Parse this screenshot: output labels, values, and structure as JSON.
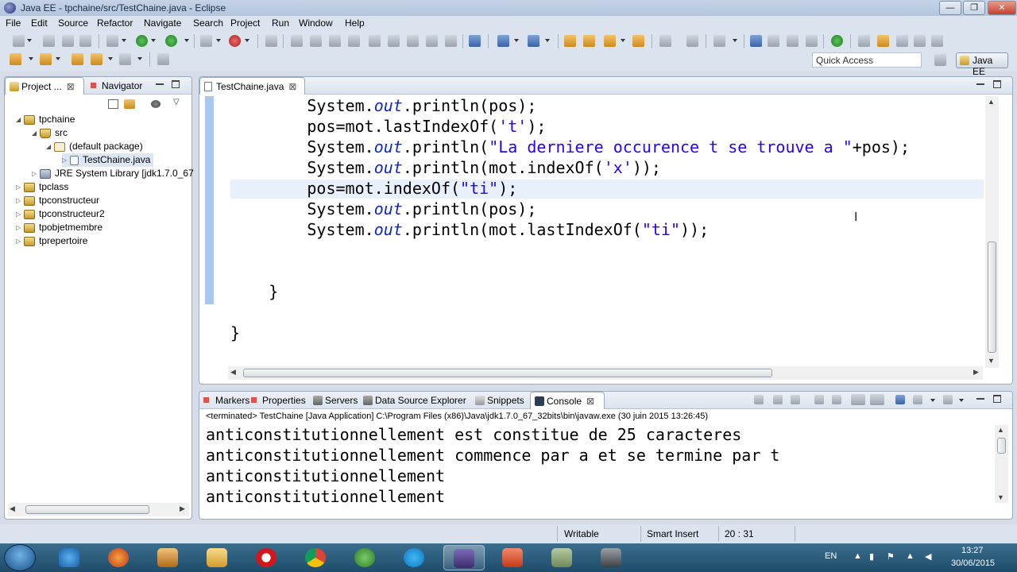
{
  "window": {
    "title": "Java EE - tpchaine/src/TestChaine.java - Eclipse",
    "min": "—",
    "restore": "❐",
    "close": "✕"
  },
  "menu": [
    "File",
    "Edit",
    "Source",
    "Refactor",
    "Navigate",
    "Search",
    "Project",
    "Run",
    "Window",
    "Help"
  ],
  "quick_access": {
    "placeholder": "Quick Access"
  },
  "perspective": {
    "label": "Java EE"
  },
  "left_panel": {
    "tabs": [
      {
        "label": "Project ..."
      },
      {
        "label": "Navigator"
      }
    ],
    "tree": [
      {
        "label": "tpchaine",
        "indent": 0,
        "twisty": "◢",
        "icon": "proj"
      },
      {
        "label": "src",
        "indent": 1,
        "twisty": "◢",
        "icon": "src"
      },
      {
        "label": "(default package)",
        "indent": 2,
        "twisty": "◢",
        "icon": "pkg"
      },
      {
        "label": "TestChaine.java",
        "indent": 3,
        "twisty": "▷",
        "icon": "java",
        "selected": true
      },
      {
        "label": "JRE System Library [jdk1.7.0_67",
        "indent": 1,
        "twisty": "▷",
        "icon": "jre"
      },
      {
        "label": "tpclass",
        "indent": 0,
        "twisty": "▷",
        "icon": "proj"
      },
      {
        "label": "tpconstructeur",
        "indent": 0,
        "twisty": "▷",
        "icon": "proj"
      },
      {
        "label": "tpconstructeur2",
        "indent": 0,
        "twisty": "▷",
        "icon": "proj"
      },
      {
        "label": "tpobjetmembre",
        "indent": 0,
        "twisty": "▷",
        "icon": "proj"
      },
      {
        "label": "tprepertoire",
        "indent": 0,
        "twisty": "▷",
        "icon": "proj"
      }
    ]
  },
  "editor": {
    "tab": "TestChaine.java",
    "lines": [
      {
        "indent": 8,
        "parts": [
          [
            "t",
            "System."
          ],
          [
            "it",
            "out"
          ],
          [
            "t",
            ".println(pos);"
          ]
        ]
      },
      {
        "indent": 8,
        "parts": [
          [
            "t",
            "pos=mot.lastIndexOf("
          ],
          [
            "s",
            "'t'"
          ],
          [
            "t",
            ");"
          ]
        ]
      },
      {
        "indent": 8,
        "parts": [
          [
            "t",
            "System."
          ],
          [
            "it",
            "out"
          ],
          [
            "t",
            ".println("
          ],
          [
            "s",
            "\"La derniere occurence t se trouve a \""
          ],
          [
            "t",
            "+pos);"
          ]
        ]
      },
      {
        "indent": 8,
        "parts": [
          [
            "t",
            "System."
          ],
          [
            "it",
            "out"
          ],
          [
            "t",
            ".println(mot.indexOf("
          ],
          [
            "s",
            "'x'"
          ],
          [
            "t",
            "));"
          ]
        ]
      },
      {
        "indent": 8,
        "parts": [
          [
            "t",
            "pos=mot.indexOf("
          ],
          [
            "s",
            "\"ti\""
          ],
          [
            "t",
            ");"
          ]
        ]
      },
      {
        "indent": 8,
        "parts": [
          [
            "t",
            "System."
          ],
          [
            "it",
            "out"
          ],
          [
            "t",
            ".println(pos);"
          ]
        ]
      },
      {
        "indent": 8,
        "parts": [
          [
            "t",
            "System."
          ],
          [
            "it",
            "out"
          ],
          [
            "t",
            ".println(mot.lastIndexOf("
          ],
          [
            "s",
            "\"ti\""
          ],
          [
            "t",
            "));"
          ]
        ]
      },
      {
        "indent": 0,
        "parts": [
          [
            "t",
            ""
          ]
        ]
      },
      {
        "indent": 0,
        "parts": [
          [
            "t",
            ""
          ]
        ]
      },
      {
        "indent": 4,
        "parts": [
          [
            "t",
            "}"
          ]
        ]
      },
      {
        "indent": 0,
        "parts": [
          [
            "t",
            ""
          ]
        ]
      },
      {
        "indent": 0,
        "parts": [
          [
            "t",
            "}"
          ]
        ]
      }
    ]
  },
  "bottom_panel": {
    "tabs": [
      {
        "label": "Markers",
        "icon": "markers-icon"
      },
      {
        "label": "Properties",
        "icon": "properties-icon"
      },
      {
        "label": "Servers",
        "icon": "servers-icon"
      },
      {
        "label": "Data Source Explorer",
        "icon": "datasource-icon"
      },
      {
        "label": "Snippets",
        "icon": "snippets-icon"
      },
      {
        "label": "Console",
        "icon": "console-icon",
        "active": true
      }
    ],
    "console_header": "<terminated> TestChaine [Java Application] C:\\Program Files (x86)\\Java\\jdk1.7.0_67_32bits\\bin\\javaw.exe (30 juin 2015 13:26:45)",
    "output": [
      "anticonstitutionnellement est constitue de 25 caracteres",
      "anticonstitutionnellement commence par a et se termine par t",
      "anticonstitutionnellement",
      "anticonstitutionnellement"
    ]
  },
  "status": {
    "writable": "Writable",
    "insert": "Smart Insert",
    "position": "20 : 31"
  },
  "taskbar": {
    "lang": "EN",
    "time": "13:27",
    "date": "30/06/2015"
  }
}
